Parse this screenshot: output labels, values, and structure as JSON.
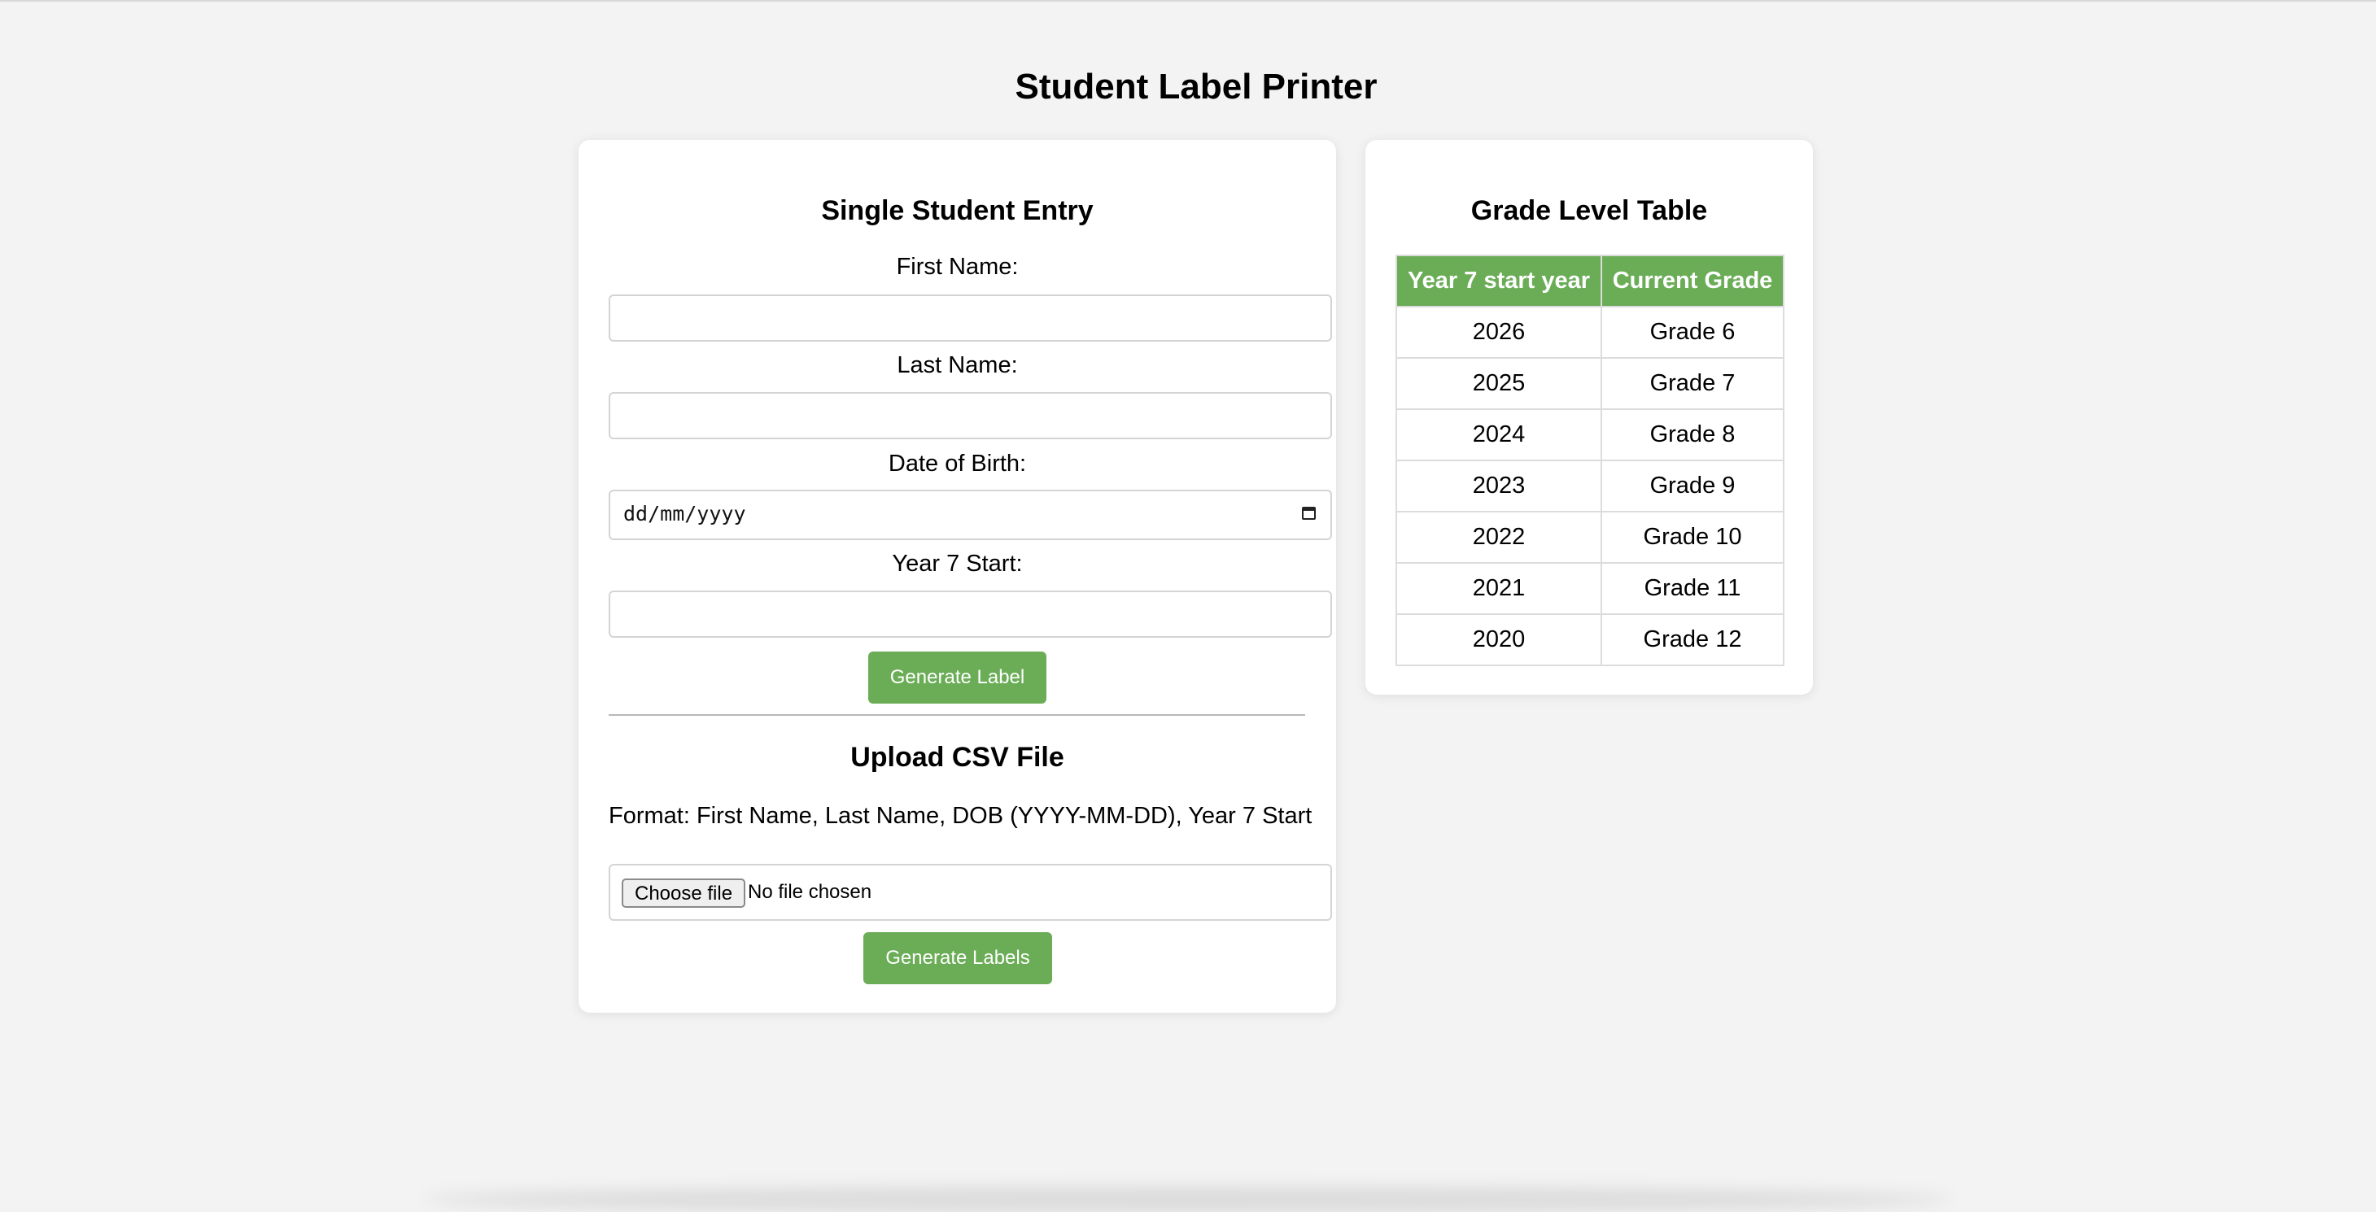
{
  "page": {
    "title": "Student Label Printer"
  },
  "single_entry": {
    "heading": "Single Student Entry",
    "first_name_label": "First Name:",
    "first_name_value": "",
    "last_name_label": "Last Name:",
    "last_name_value": "",
    "dob_label": "Date of Birth:",
    "dob_placeholder": "dd/mm/yyyy",
    "year7_label": "Year 7 Start:",
    "year7_value": "",
    "generate_button": "Generate Label"
  },
  "csv_upload": {
    "heading": "Upload CSV File",
    "format_text": "Format: First Name, Last Name, DOB (YYYY-MM-DD), Year 7 Start",
    "choose_file_button": "Choose file",
    "file_status": "No file chosen",
    "generate_button": "Generate Labels"
  },
  "grade_table": {
    "heading": "Grade Level Table",
    "columns": [
      "Year 7 start year",
      "Current Grade"
    ],
    "rows": [
      [
        "2026",
        "Grade 6"
      ],
      [
        "2025",
        "Grade 7"
      ],
      [
        "2024",
        "Grade 8"
      ],
      [
        "2023",
        "Grade 9"
      ],
      [
        "2022",
        "Grade 10"
      ],
      [
        "2021",
        "Grade 11"
      ],
      [
        "2020",
        "Grade 12"
      ]
    ]
  },
  "colors": {
    "accent": "#6aad56",
    "background": "#f3f3f3"
  },
  "icons": {
    "date_picker": "calendar-icon"
  }
}
